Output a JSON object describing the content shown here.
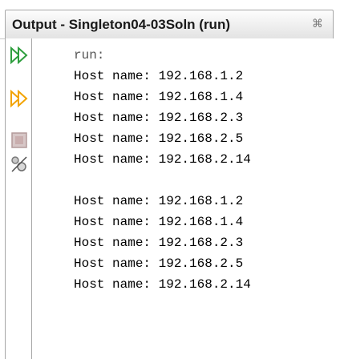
{
  "tab": {
    "title": "Output - Singleton04-03Soln (run)",
    "close_glyph": "⌘"
  },
  "toolbar": {
    "icons": [
      "rerun-icon",
      "rerun-with-options-icon",
      "stop-icon",
      "settings-icon"
    ]
  },
  "output": {
    "lines": [
      "run:",
      "Host name: 192.168.1.2",
      "Host name: 192.168.1.4",
      "Host name: 192.168.2.3",
      "Host name: 192.168.2.5",
      "Host name: 192.168.2.14",
      "",
      "Host name: 192.168.1.2",
      "Host name: 192.168.1.4",
      "Host name: 192.168.2.3",
      "Host name: 192.168.2.5",
      "Host name: 192.168.2.14"
    ]
  },
  "colors": {
    "rerun_green": "#39b54a",
    "stop_gray": "#c6b5b5",
    "text": "#000000"
  }
}
